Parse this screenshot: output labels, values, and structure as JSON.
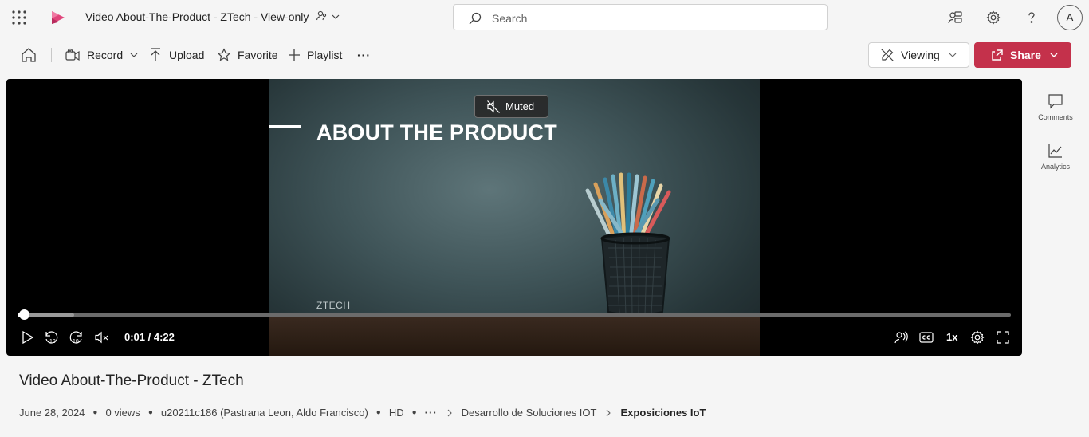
{
  "header": {
    "document_title": "Video About-The-Product - ZTech - View-only",
    "search_placeholder": "Search",
    "avatar_initial": "A",
    "icons": [
      "waffle-icon",
      "stream-logo-icon",
      "people-icon",
      "chevron-down-icon",
      "search-icon",
      "feedback-icon",
      "settings-icon",
      "help-icon"
    ]
  },
  "toolbar": {
    "record_label": "Record",
    "upload_label": "Upload",
    "favorite_label": "Favorite",
    "playlist_label": "Playlist",
    "more_label": "···",
    "viewing_label": "Viewing",
    "share_label": "Share"
  },
  "colors": {
    "share_button": "#c4314b",
    "accent_logo": "#e0457b",
    "player_background": "#000000"
  },
  "player": {
    "headline": "ABOUT THE PRODUCT",
    "brand": "ZTECH",
    "muted_label": "Muted",
    "time_display": "0:01 / 4:22",
    "playback_rate": "1x",
    "progress_fraction": 0.004,
    "buffered_fraction": 0.057
  },
  "side_rail": {
    "comments_label": "Comments",
    "analytics_label": "Analytics"
  },
  "video": {
    "title": "Video About-The-Product - ZTech",
    "date": "June 28, 2024",
    "views": "0 views",
    "owner": "u20211c186 (Pastrana Leon, Aldo Francisco)",
    "quality": "HD",
    "breadcrumb_more": "···",
    "breadcrumb_parent": "Desarrollo de Soluciones IOT",
    "breadcrumb_current": "Exposiciones IoT"
  }
}
